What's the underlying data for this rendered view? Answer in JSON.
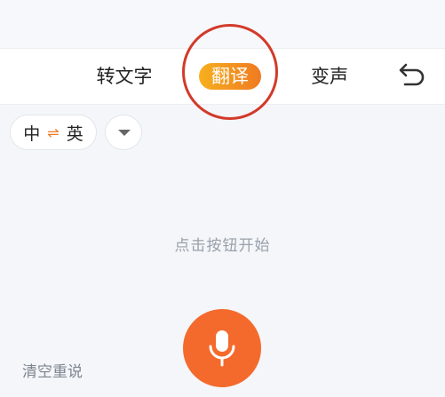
{
  "tabs": {
    "transcribe": "转文字",
    "translate": "翻译",
    "voice_change": "变声"
  },
  "language": {
    "source": "中",
    "swap_icon": "⇌",
    "target": "英"
  },
  "hint": "点击按钮开始",
  "clear_label": "清空重说",
  "icons": {
    "undo": "undo-icon",
    "dropdown": "chevron-down-icon",
    "mic": "microphone-icon"
  },
  "colors": {
    "accent": "#f46a2c",
    "tab_gradient_start": "#f6b01e",
    "tab_gradient_end": "#f07a22",
    "annotation_circle": "#d23a2a"
  }
}
